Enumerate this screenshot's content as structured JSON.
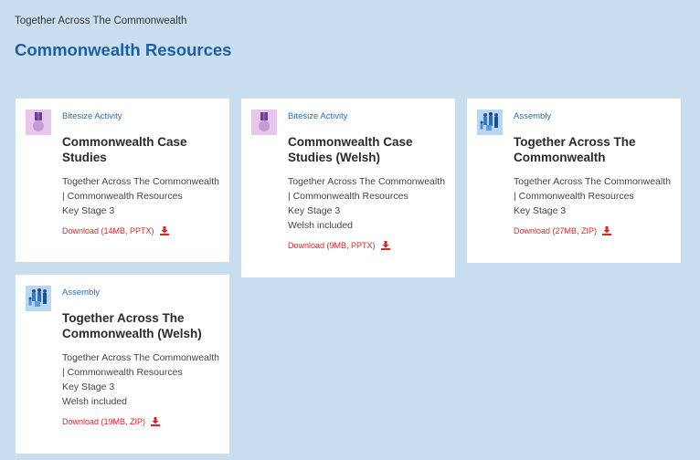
{
  "breadcrumb": "Together Across The Commonwealth",
  "page_title": "Commonwealth Resources",
  "colors": {
    "background": "#c9dff0",
    "title": "#1c5fa8",
    "type_link": "#2a6db5",
    "download": "#d8262b"
  },
  "cards": [
    {
      "icon": "medal-icon",
      "type": "Bitesize Activity",
      "title": "Commonwealth Case Studies",
      "description": "Together Across The Commonwealth | Commonwealth Resources",
      "key_stage": "Key Stage 3",
      "welsh": "",
      "download": "Download (14MB, PPTX)"
    },
    {
      "icon": "medal-icon",
      "type": "Bitesize Activity",
      "title": "Commonwealth Case Studies (Welsh)",
      "description": "Together Across The Commonwealth | Commonwealth Resources",
      "key_stage": "Key Stage 3",
      "welsh": "Welsh included",
      "download": "Download (9MB, PPTX)"
    },
    {
      "icon": "people-group-icon",
      "type": "Assembly",
      "title": "Together Across The Commonwealth",
      "description": "Together Across The Commonwealth | Commonwealth Resources",
      "key_stage": "Key Stage 3",
      "welsh": "",
      "download": "Download (27MB, ZIP)"
    },
    {
      "icon": "people-group-icon",
      "type": "Assembly",
      "title": "Together Across The Commonwealth (Welsh)",
      "description": "Together Across The Commonwealth | Commonwealth Resources",
      "key_stage": "Key Stage 3",
      "welsh": "Welsh included",
      "download": "Download (19MB, ZIP)"
    }
  ]
}
